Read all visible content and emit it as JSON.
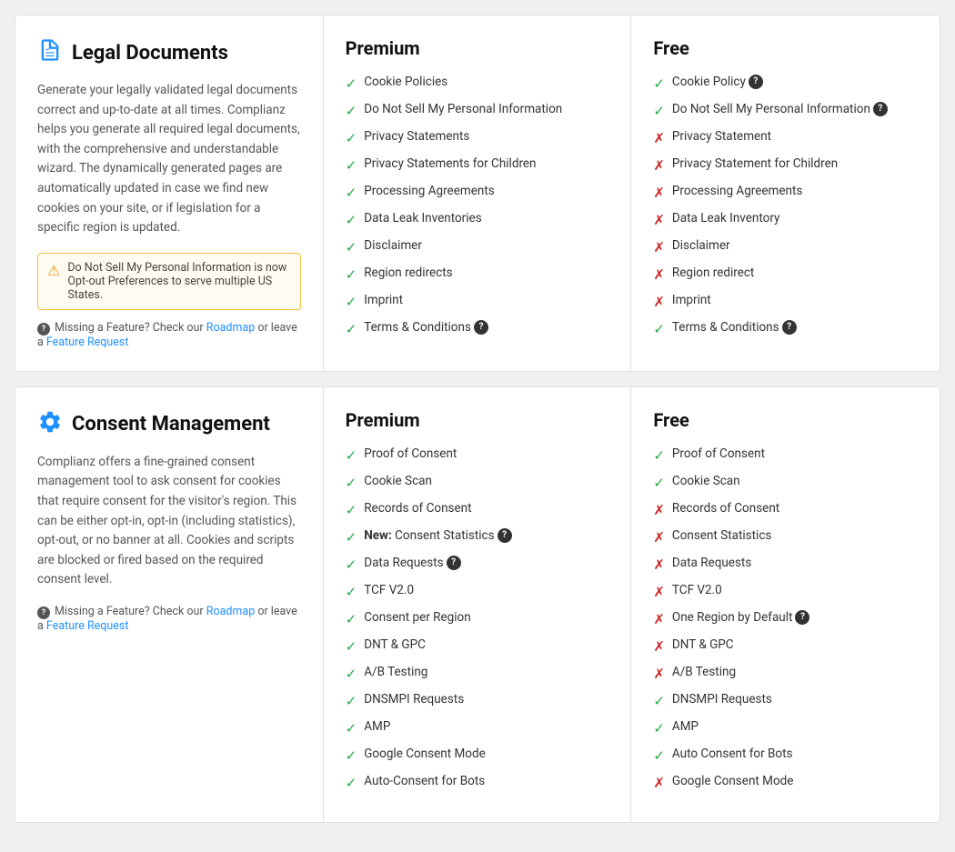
{
  "sections": [
    {
      "id": "legal-documents",
      "icon": "📄",
      "title": "Legal Documents",
      "description": "Generate your legally validated legal documents correct and up-to-date at all times. Complianz helps you generate all required legal documents, with the comprehensive and understandable wizard. The dynamically generated pages are automatically updated in case we find new cookies on your site, or if legislation for a specific region is updated.",
      "notice": "Do Not Sell My Personal Information is now Opt-out Preferences to serve multiple US States.",
      "missing_feature_text": "Missing a Feature? Check our",
      "roadmap_label": "Roadmap",
      "or_label": "or leave a",
      "feature_request_label": "Feature Request",
      "premium_title": "Premium",
      "free_title": "Free",
      "premium_features": [
        {
          "label": "Cookie Policies",
          "check": true,
          "help": false,
          "new": false
        },
        {
          "label": "Do Not Sell My Personal Information",
          "check": true,
          "help": false,
          "new": false
        },
        {
          "label": "Privacy Statements",
          "check": true,
          "help": false,
          "new": false
        },
        {
          "label": "Privacy Statements for Children",
          "check": true,
          "help": false,
          "new": false
        },
        {
          "label": "Processing Agreements",
          "check": true,
          "help": false,
          "new": false
        },
        {
          "label": "Data Leak Inventories",
          "check": true,
          "help": false,
          "new": false
        },
        {
          "label": "Disclaimer",
          "check": true,
          "help": false,
          "new": false
        },
        {
          "label": "Region redirects",
          "check": true,
          "help": false,
          "new": false
        },
        {
          "label": "Imprint",
          "check": true,
          "help": false,
          "new": false
        },
        {
          "label": "Terms & Conditions",
          "check": true,
          "help": true,
          "new": false
        }
      ],
      "free_features": [
        {
          "label": "Cookie Policy",
          "check": true,
          "help": true,
          "new": false
        },
        {
          "label": "Do Not Sell My Personal Information",
          "check": true,
          "help": true,
          "new": false
        },
        {
          "label": "Privacy Statement",
          "check": false,
          "help": false,
          "new": false
        },
        {
          "label": "Privacy Statement for Children",
          "check": false,
          "help": false,
          "new": false
        },
        {
          "label": "Processing Agreements",
          "check": false,
          "help": false,
          "new": false
        },
        {
          "label": "Data Leak Inventory",
          "check": false,
          "help": false,
          "new": false
        },
        {
          "label": "Disclaimer",
          "check": false,
          "help": false,
          "new": false
        },
        {
          "label": "Region redirect",
          "check": false,
          "help": false,
          "new": false
        },
        {
          "label": "Imprint",
          "check": false,
          "help": false,
          "new": false
        },
        {
          "label": "Terms & Conditions",
          "check": true,
          "help": true,
          "new": false
        }
      ]
    },
    {
      "id": "consent-management",
      "icon": "⚙",
      "title": "Consent Management",
      "description": "Complianz offers a fine-grained consent management tool to ask consent for cookies that require consent for the visitor's region. This can be either opt-in, opt-in (including statistics), opt-out, or no banner at all. Cookies and scripts are blocked or fired based on the required consent level.",
      "notice": null,
      "missing_feature_text": "Missing a Feature? Check our",
      "roadmap_label": "Roadmap",
      "or_label": "or leave a",
      "feature_request_label": "Feature Request",
      "premium_title": "Premium",
      "free_title": "Free",
      "premium_features": [
        {
          "label": "Proof of Consent",
          "check": true,
          "help": false,
          "new": false
        },
        {
          "label": "Cookie Scan",
          "check": true,
          "help": false,
          "new": false
        },
        {
          "label": "Records of Consent",
          "check": true,
          "help": false,
          "new": false
        },
        {
          "label": "Consent Statistics",
          "check": true,
          "help": true,
          "new": true
        },
        {
          "label": "Data Requests",
          "check": true,
          "help": true,
          "new": false
        },
        {
          "label": "TCF V2.0",
          "check": true,
          "help": false,
          "new": false
        },
        {
          "label": "Consent per Region",
          "check": true,
          "help": false,
          "new": false
        },
        {
          "label": "DNT & GPC",
          "check": true,
          "help": false,
          "new": false
        },
        {
          "label": "A/B Testing",
          "check": true,
          "help": false,
          "new": false
        },
        {
          "label": "DNSMPI Requests",
          "check": true,
          "help": false,
          "new": false
        },
        {
          "label": "AMP",
          "check": true,
          "help": false,
          "new": false
        },
        {
          "label": "Google Consent Mode",
          "check": true,
          "help": false,
          "new": false
        },
        {
          "label": "Auto-Consent for Bots",
          "check": true,
          "help": false,
          "new": false
        }
      ],
      "free_features": [
        {
          "label": "Proof of Consent",
          "check": true,
          "help": false,
          "new": false
        },
        {
          "label": "Cookie Scan",
          "check": true,
          "help": false,
          "new": false
        },
        {
          "label": "Records of Consent",
          "check": false,
          "help": false,
          "new": false
        },
        {
          "label": "Consent Statistics",
          "check": false,
          "help": false,
          "new": false
        },
        {
          "label": "Data Requests",
          "check": false,
          "help": false,
          "new": false
        },
        {
          "label": "TCF V2.0",
          "check": false,
          "help": false,
          "new": false
        },
        {
          "label": "One Region by Default",
          "check": false,
          "help": true,
          "new": false
        },
        {
          "label": "DNT & GPC",
          "check": false,
          "help": false,
          "new": false
        },
        {
          "label": "A/B Testing",
          "check": false,
          "help": false,
          "new": false
        },
        {
          "label": "DNSMPI Requests",
          "check": true,
          "help": false,
          "new": false
        },
        {
          "label": "AMP",
          "check": true,
          "help": false,
          "new": false
        },
        {
          "label": "Auto Consent for Bots",
          "check": true,
          "help": false,
          "new": false
        },
        {
          "label": "Google Consent Mode",
          "check": false,
          "help": false,
          "new": false
        }
      ]
    }
  ],
  "colors": {
    "check": "#22aa44",
    "cross": "#cc2222",
    "link": "#1e90ff",
    "notice_bg": "#fffbf0",
    "notice_border": "#f0c040"
  }
}
